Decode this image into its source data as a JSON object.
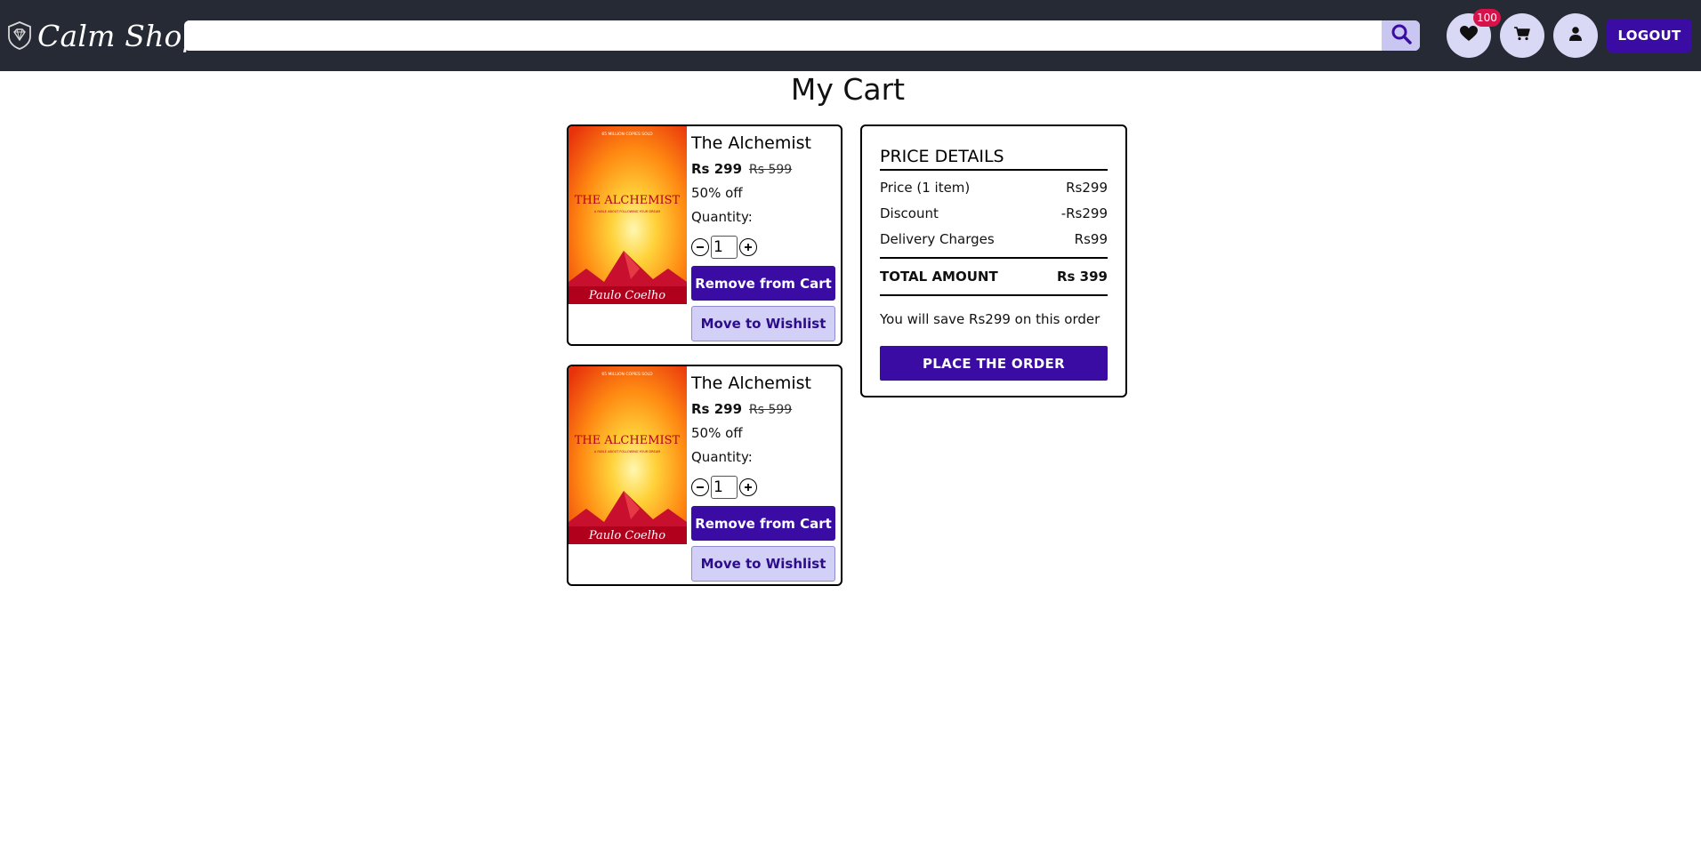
{
  "brand": {
    "name": "Calm Shop",
    "logo_icon": "diamond-shield-icon"
  },
  "search": {
    "placeholder": "",
    "icon": "search-icon"
  },
  "header": {
    "wishlist_icon": "heart-icon",
    "wishlist_count": "100",
    "cart_icon": "cart-icon",
    "user_icon": "user-icon",
    "logout_label": "LOGOUT"
  },
  "page": {
    "title": "My Cart"
  },
  "cart_items": [
    {
      "title": "The Alchemist",
      "price": "Rs 299",
      "original_price": "Rs 599",
      "discount": "50% off",
      "quantity_label": "Quantity:",
      "quantity": "1",
      "remove_label": "Remove from Cart",
      "wishlist_label": "Move to Wishlist",
      "cover": {
        "top_text": "65 MILLION COPIES SOLD",
        "title": "THE ALCHEMIST",
        "subtitle": "A FABLE ABOUT FOLLOWING YOUR DREAM",
        "author": "Paulo Coelho"
      }
    },
    {
      "title": "The Alchemist",
      "price": "Rs 299",
      "original_price": "Rs 599",
      "discount": "50% off",
      "quantity_label": "Quantity:",
      "quantity": "1",
      "remove_label": "Remove from Cart",
      "wishlist_label": "Move to Wishlist",
      "cover": {
        "top_text": "65 MILLION COPIES SOLD",
        "title": "THE ALCHEMIST",
        "subtitle": "A FABLE ABOUT FOLLOWING YOUR DREAM",
        "author": "Paulo Coelho"
      }
    }
  ],
  "price_details": {
    "title": "PRICE DETAILS",
    "rows": [
      {
        "label": "Price (1 item)",
        "value": "Rs299"
      },
      {
        "label": "Discount",
        "value": "-Rs299"
      },
      {
        "label": "Delivery Charges",
        "value": "Rs99"
      }
    ],
    "total_label": "TOTAL AMOUNT",
    "total_value": "Rs 399",
    "save_text": "You will save Rs299 on this order",
    "place_order_label": "PLACE THE ORDER"
  },
  "colors": {
    "navbar_bg": "#252a34",
    "primary": "#3a0ca3",
    "secondary_bg": "#d2d0f7",
    "icon_circle": "#dad9f5",
    "badge": "#d6124a"
  }
}
